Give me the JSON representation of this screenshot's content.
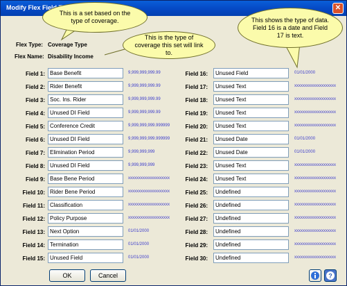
{
  "window": {
    "title": "Modify Flex Field Titles"
  },
  "header": {
    "flex_type_label": "Flex Type:",
    "flex_type_value": "Coverage Type",
    "flex_name_label": "Flex Name:",
    "flex_name_value": "Disability Income"
  },
  "left_fields": [
    {
      "label": "Field 1:",
      "value": "Base Benefit",
      "format": "9,999,999,999.99"
    },
    {
      "label": "Field 2:",
      "value": "Rider Benefit",
      "format": "9,999,999,999.99"
    },
    {
      "label": "Field 3:",
      "value": "Soc. Ins. Rider",
      "format": "9,999,999,999.99"
    },
    {
      "label": "Field 4:",
      "value": "Unused DI Field",
      "format": "9,999,999,999.99"
    },
    {
      "label": "Field 5:",
      "value": "Conference Credit",
      "format": "9,999,999,999.999999"
    },
    {
      "label": "Field 6:",
      "value": "Unused DI Field",
      "format": "9,999,999,999.999999"
    },
    {
      "label": "Field 7:",
      "value": "Elimination Period",
      "format": "9,999,999,999"
    },
    {
      "label": "Field 8:",
      "value": "Unused DI Field",
      "format": "9,999,999,999"
    },
    {
      "label": "Field 9:",
      "value": "Base Bene Period",
      "format": "xxxxxxxxxxxxxxxxxxxx"
    },
    {
      "label": "Field 10:",
      "value": "Rider Bene Period",
      "format": "xxxxxxxxxxxxxxxxxxxx"
    },
    {
      "label": "Field 11:",
      "value": "Classification",
      "format": "xxxxxxxxxxxxxxxxxxxx"
    },
    {
      "label": "Field 12:",
      "value": "Policy Purpose",
      "format": "xxxxxxxxxxxxxxxxxxxx"
    },
    {
      "label": "Field 13:",
      "value": "Next Option",
      "format": "01/01/2000"
    },
    {
      "label": "Field 14:",
      "value": "Termination",
      "format": "01/01/2000"
    },
    {
      "label": "Field 15:",
      "value": "Unused Field",
      "format": "01/01/2000"
    }
  ],
  "right_fields": [
    {
      "label": "Field 16:",
      "value": "Unused Field",
      "format": "01/01/2000"
    },
    {
      "label": "Field 17:",
      "value": "Unused Text",
      "format": "xxxxxxxxxxxxxxxxxxxx"
    },
    {
      "label": "Field 18:",
      "value": "Unused Text",
      "format": "xxxxxxxxxxxxxxxxxxxx"
    },
    {
      "label": "Field 19:",
      "value": "Unused Text",
      "format": "xxxxxxxxxxxxxxxxxxxx"
    },
    {
      "label": "Field 20:",
      "value": "Unused Text",
      "format": "xxxxxxxxxxxxxxxxxxxx"
    },
    {
      "label": "Field 21:",
      "value": "Unused Date",
      "format": "01/01/2000"
    },
    {
      "label": "Field 22:",
      "value": "Unused Date",
      "format": "01/01/2000"
    },
    {
      "label": "Field 23:",
      "value": "Unused Text",
      "format": "xxxxxxxxxxxxxxxxxxxx"
    },
    {
      "label": "Field 24:",
      "value": "Unused Text",
      "format": "xxxxxxxxxxxxxxxxxxxx"
    },
    {
      "label": "Field 25:",
      "value": "Undefined",
      "format": "xxxxxxxxxxxxxxxxxxxx"
    },
    {
      "label": "Field 26:",
      "value": "Undefined",
      "format": "xxxxxxxxxxxxxxxxxxxx"
    },
    {
      "label": "Field 27:",
      "value": "Undefined",
      "format": "xxxxxxxxxxxxxxxxxxxx"
    },
    {
      "label": "Field 28:",
      "value": "Undefined",
      "format": "xxxxxxxxxxxxxxxxxxxx"
    },
    {
      "label": "Field 29:",
      "value": "Undefined",
      "format": "xxxxxxxxxxxxxxxxxxxx"
    },
    {
      "label": "Field 30:",
      "value": "Undefined",
      "format": "xxxxxxxxxxxxxxxxxxxx"
    }
  ],
  "buttons": {
    "ok": "OK",
    "cancel": "Cancel"
  },
  "icons": {
    "info": "info-icon",
    "help": "help-icon",
    "close": "close-icon"
  },
  "callouts": {
    "coverage_set": "This is a set based on the type of coverage.",
    "link_to": "This is the type of coverage this set will link to.",
    "data_type": "This shows the type of data.  Field 16 is a date and Field 17 is text."
  },
  "colors": {
    "callout_fill": "#fbfbab",
    "format_text": "#3c3ccc",
    "titlebar": "#0548c4"
  }
}
